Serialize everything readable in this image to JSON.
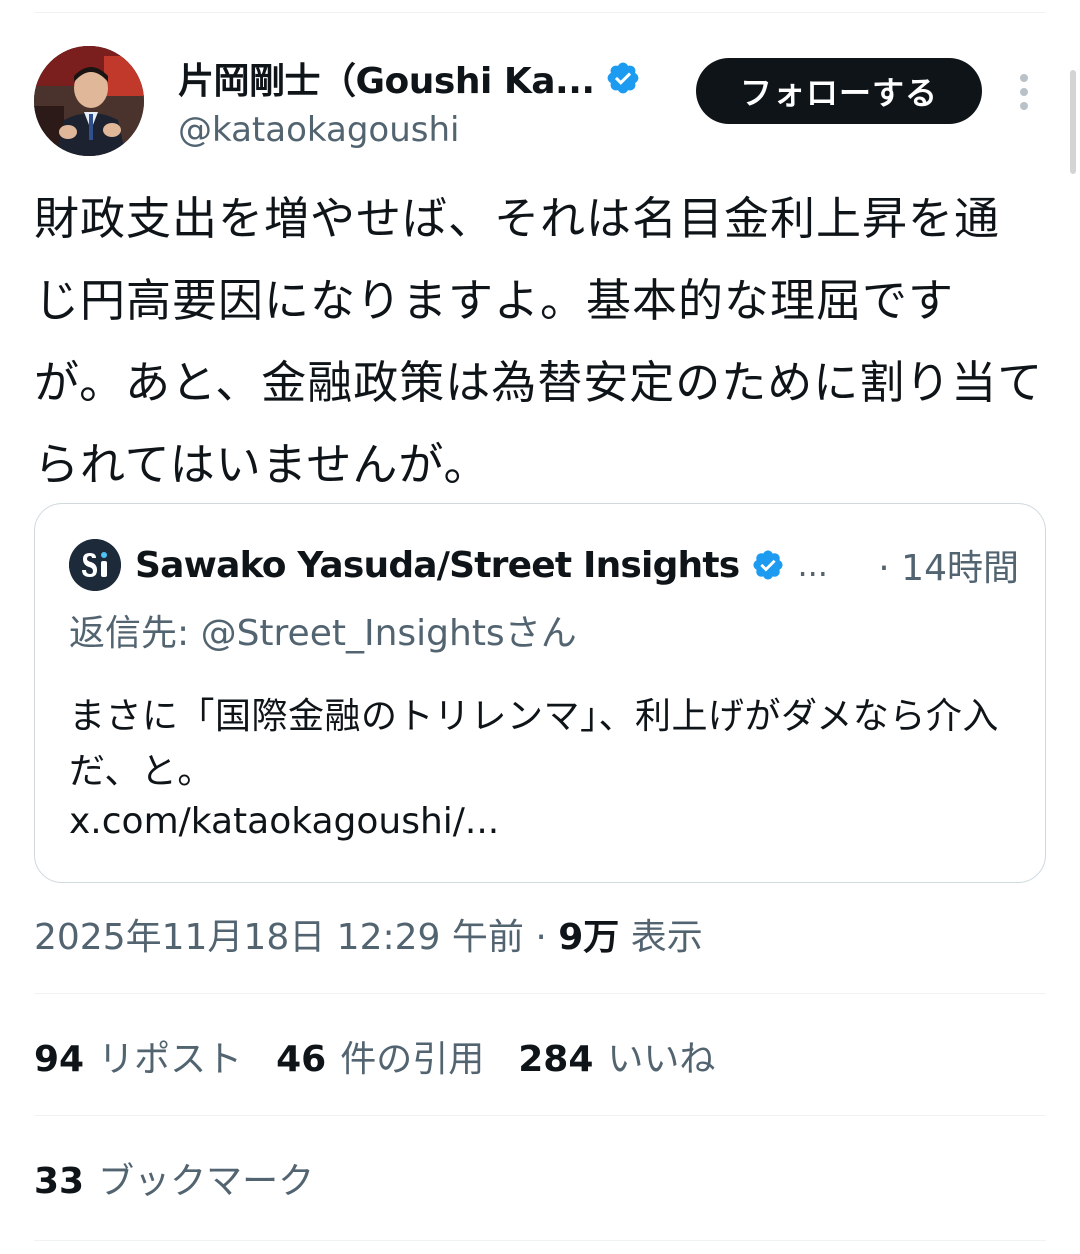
{
  "author": {
    "display_name": "片岡剛士（Goushi Ka...",
    "handle": "@kataokagoushi",
    "verified": true,
    "follow_label": "フォローする"
  },
  "tweet": {
    "text": "財政支出を増やせば、それは名目金利上昇を通じ円高要因になりますよ。基本的な理屈ですが。あと、金融政策は為替安定のために割り当てられてはいませんが。"
  },
  "quote": {
    "author_name": "Sawako Yasuda/Street Insights",
    "verified": true,
    "ellipsis": "...",
    "time": "· 14時間",
    "reply_to": "返信先: @Street_Insightsさん",
    "text": "まさに「国際金融のトリレンマ」、利上げがダメなら介入だ、と。",
    "link": "x.com/kataokagoushi/..."
  },
  "meta": {
    "timestamp": "2025年11月18日 12:29 午前",
    "separator": " · ",
    "views_count": "9万",
    "views_label": "表示"
  },
  "stats": {
    "reposts": {
      "count": "94",
      "label": "リポスト"
    },
    "quotes": {
      "count": "46",
      "label": "件の引用"
    },
    "likes": {
      "count": "284",
      "label": "いいね"
    },
    "bookmarks": {
      "count": "33",
      "label": "ブックマーク"
    }
  },
  "colors": {
    "verified_blue": "#1d9bf0",
    "secondary_text": "#536471",
    "primary_text": "#0f1419",
    "follow_bg": "#0f1419"
  },
  "icons": {
    "verified": "verified-badge-icon",
    "more": "more-vertical-icon"
  }
}
